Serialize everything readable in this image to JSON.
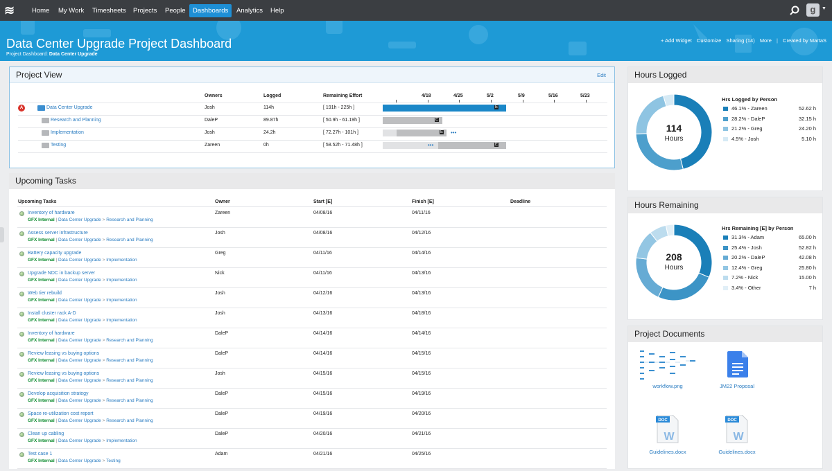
{
  "nav": {
    "items": [
      "Home",
      "My Work",
      "Timesheets",
      "Projects",
      "People",
      "Dashboards",
      "Analytics",
      "Help"
    ],
    "active": "Dashboards",
    "avatar_letter": "g"
  },
  "header": {
    "title": "Data Center Upgrade Project Dashboard",
    "breadcrumb_prefix": "Project Dashboard:",
    "breadcrumb_current": "Data Center Upgrade",
    "actions": [
      "+ Add Widget",
      "Customize",
      "Sharing (14)",
      "More",
      "|",
      "Created by MartaS"
    ]
  },
  "project_view": {
    "title": "Project View",
    "edit_label": "Edit",
    "columns": {
      "owners": "Owners",
      "logged": "Logged",
      "remaining": "Remaining Effort"
    },
    "timeline_labels": [
      "4/18",
      "4/25",
      "5/2",
      "5/9",
      "5/16",
      "5/23"
    ],
    "alert_badge": "A",
    "rows": [
      {
        "name": "Data Center Upgrade",
        "owner": "Josh",
        "logged": "114h",
        "remaining": "[ 191h - 225h ]"
      },
      {
        "name": "Research and Planning",
        "owner": "DaleP",
        "logged": "89.87h",
        "remaining": "[ 50.9h - 61.19h ]"
      },
      {
        "name": "Implementation",
        "owner": "Josh",
        "logged": "24.2h",
        "remaining": "[ 72.27h - 101h ]"
      },
      {
        "name": "Testing",
        "owner": "Zareen",
        "logged": "0h",
        "remaining": "[ 58.52h - 71.48h ]"
      }
    ],
    "bar_marker": "E"
  },
  "upcoming": {
    "title": "Upcoming Tasks",
    "columns": {
      "task": "Upcoming Tasks",
      "owner": "Owner",
      "start": "Start [E]",
      "finish": "Finish [E]",
      "deadline": "Deadline"
    },
    "client": "GFX Internal",
    "project": "Data Center Upgrade",
    "sep": ">",
    "pipe": "|",
    "tasks": [
      {
        "name": "Inventory of hardware",
        "phase": "Research and Planning",
        "owner": "Zareen",
        "start": "04/08/16",
        "finish": "04/11/16"
      },
      {
        "name": "Assess server infrastructure",
        "phase": "Research and Planning",
        "owner": "Josh",
        "start": "04/08/16",
        "finish": "04/12/16"
      },
      {
        "name": "Battery capacity upgrade",
        "phase": "Implementation",
        "owner": "Greg",
        "start": "04/11/16",
        "finish": "04/14/16"
      },
      {
        "name": "Upgrade NDC in backup server",
        "phase": "Implementation",
        "owner": "Nick",
        "start": "04/11/16",
        "finish": "04/13/16"
      },
      {
        "name": "Web tier rebuild",
        "phase": "Implementation",
        "owner": "Josh",
        "start": "04/12/16",
        "finish": "04/13/16"
      },
      {
        "name": "Install cluster rack A-D",
        "phase": "Implementation",
        "owner": "Josh",
        "start": "04/13/16",
        "finish": "04/18/16"
      },
      {
        "name": "Inventory of hardware",
        "phase": "Research and Planning",
        "owner": "DaleP",
        "start": "04/14/16",
        "finish": "04/14/16"
      },
      {
        "name": "Review leasing vs buying options",
        "phase": "Research and Planning",
        "owner": "DaleP",
        "start": "04/14/16",
        "finish": "04/15/16"
      },
      {
        "name": "Review leasing vs buying options",
        "phase": "Research and Planning",
        "owner": "Josh",
        "start": "04/15/16",
        "finish": "04/15/16"
      },
      {
        "name": "Develop acquisition strategy",
        "phase": "Research and Planning",
        "owner": "DaleP",
        "start": "04/15/16",
        "finish": "04/19/16"
      },
      {
        "name": "Space re-utilization cost report",
        "phase": "Research and Planning",
        "owner": "DaleP",
        "start": "04/19/16",
        "finish": "04/20/16"
      },
      {
        "name": "Clean up cabling",
        "phase": "Implementation",
        "owner": "DaleP",
        "start": "04/20/16",
        "finish": "04/21/16"
      },
      {
        "name": "Test case 1",
        "phase": "Testing",
        "owner": "Adam",
        "start": "04/21/16",
        "finish": "04/25/16"
      }
    ]
  },
  "hours_logged": {
    "title": "Hours Logged",
    "center_value": "114",
    "center_label": "Hours",
    "legend_title": "Hrs Logged by Person",
    "rows": [
      {
        "label": "46.1% - Zareen",
        "value": "52.62 h",
        "pct": 46.1,
        "color": "#1a7fb8"
      },
      {
        "label": "28.2% - DaleP",
        "value": "32.15 h",
        "pct": 28.2,
        "color": "#4d9fcc"
      },
      {
        "label": "21.2% - Greg",
        "value": "24.20 h",
        "pct": 21.2,
        "color": "#8ec4e2"
      },
      {
        "label": "4.5% - Josh",
        "value": "5.10 h",
        "pct": 4.5,
        "color": "#d6eaf5"
      }
    ]
  },
  "hours_remaining": {
    "title": "Hours Remaining",
    "center_value": "208",
    "center_label": "Hours",
    "legend_title": "Hrs Remaining [E] by Person",
    "rows": [
      {
        "label": "31.3% - Adam",
        "value": "65.00 h",
        "pct": 31.3,
        "color": "#1a7fb8"
      },
      {
        "label": "25.4% - Josh",
        "value": "52.82 h",
        "pct": 25.4,
        "color": "#3c94c6"
      },
      {
        "label": "20.2% - DaleP",
        "value": "42.08 h",
        "pct": 20.2,
        "color": "#66abd4"
      },
      {
        "label": "12.4% - Greg",
        "value": "25.80 h",
        "pct": 12.4,
        "color": "#93c6e3"
      },
      {
        "label": "7.2% - Nick",
        "value": "15.00 h",
        "pct": 7.2,
        "color": "#bcdcee"
      },
      {
        "label": "3.4% - Other",
        "value": "7 h",
        "pct": 3.4,
        "color": "#e1eff7"
      }
    ]
  },
  "documents": {
    "title": "Project Documents",
    "doc_badge": "DOC",
    "files": [
      "workflow.png",
      "JM22 Proposal",
      "Guidelines.docx",
      "Guidelines.docx"
    ]
  }
}
